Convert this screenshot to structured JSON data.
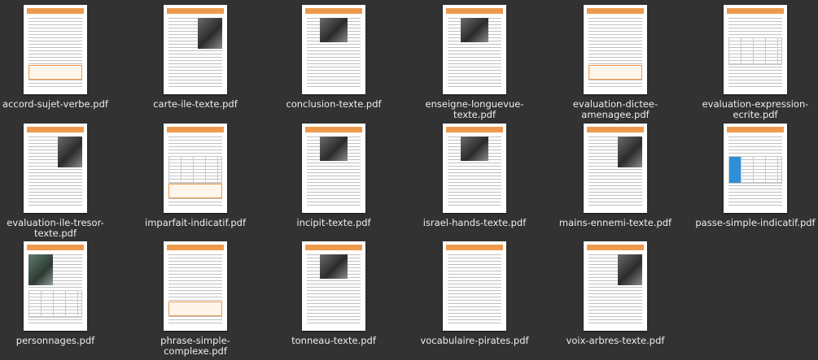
{
  "files": [
    {
      "name": "accord-sujet-verbe.pdf",
      "thumb": "worksheet"
    },
    {
      "name": "carte-ile-texte.pdf",
      "thumb": "text-image"
    },
    {
      "name": "conclusion-texte.pdf",
      "thumb": "text-image-mid"
    },
    {
      "name": "enseigne-longuevue-texte.pdf",
      "thumb": "text-image-mid"
    },
    {
      "name": "evaluation-dictee-amenagee.pdf",
      "thumb": "worksheet"
    },
    {
      "name": "evaluation-expression-ecrite.pdf",
      "thumb": "table"
    },
    {
      "name": "evaluation-ile-tresor-texte.pdf",
      "thumb": "text-image"
    },
    {
      "name": "imparfait-indicatif.pdf",
      "thumb": "table-box"
    },
    {
      "name": "incipit-texte.pdf",
      "thumb": "text-image-mid"
    },
    {
      "name": "israel-hands-texte.pdf",
      "thumb": "text-image-mid"
    },
    {
      "name": "mains-ennemi-texte.pdf",
      "thumb": "text-image"
    },
    {
      "name": "passe-simple-indicatif.pdf",
      "thumb": "table-blue"
    },
    {
      "name": "personnages.pdf",
      "thumb": "image-left-table"
    },
    {
      "name": "phrase-simple-complexe.pdf",
      "thumb": "worksheet"
    },
    {
      "name": "tonneau-texte.pdf",
      "thumb": "text-image-mid"
    },
    {
      "name": "vocabulaire-pirates.pdf",
      "thumb": "text"
    },
    {
      "name": "voix-arbres-texte.pdf",
      "thumb": "text-image"
    }
  ],
  "thumbnail_colors": {
    "header": "#ee9a4d",
    "page": "#ffffff",
    "background": "#323232"
  }
}
